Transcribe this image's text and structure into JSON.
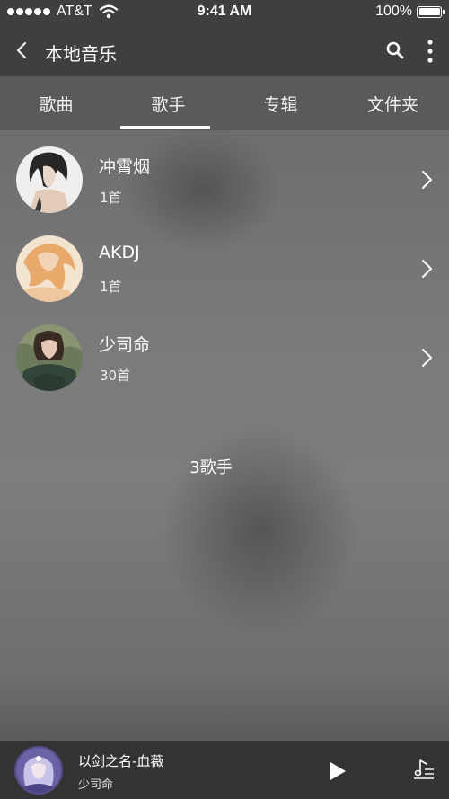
{
  "status_bar": {
    "carrier": "AT&T",
    "time": "9:41 AM",
    "battery": "100%",
    "battery_level": 1.0
  },
  "header": {
    "title": "本地音乐"
  },
  "tabs": [
    {
      "label": "歌曲",
      "selected": false
    },
    {
      "label": "歌手",
      "selected": true
    },
    {
      "label": "专辑",
      "selected": false
    },
    {
      "label": "文件夹",
      "selected": false
    }
  ],
  "artists": [
    {
      "name": "冲霄烟",
      "count": "1首"
    },
    {
      "name": "AKDJ",
      "count": "1首"
    },
    {
      "name": "少司命",
      "count": "30首"
    }
  ],
  "summary": "3歌手",
  "player": {
    "song_title": "以剑之名-血薇",
    "song_artist": "少司命"
  },
  "colors": {
    "bar_background": "#3f3f3f",
    "tab_background": "#5a5a5a",
    "player_background": "#333333"
  }
}
